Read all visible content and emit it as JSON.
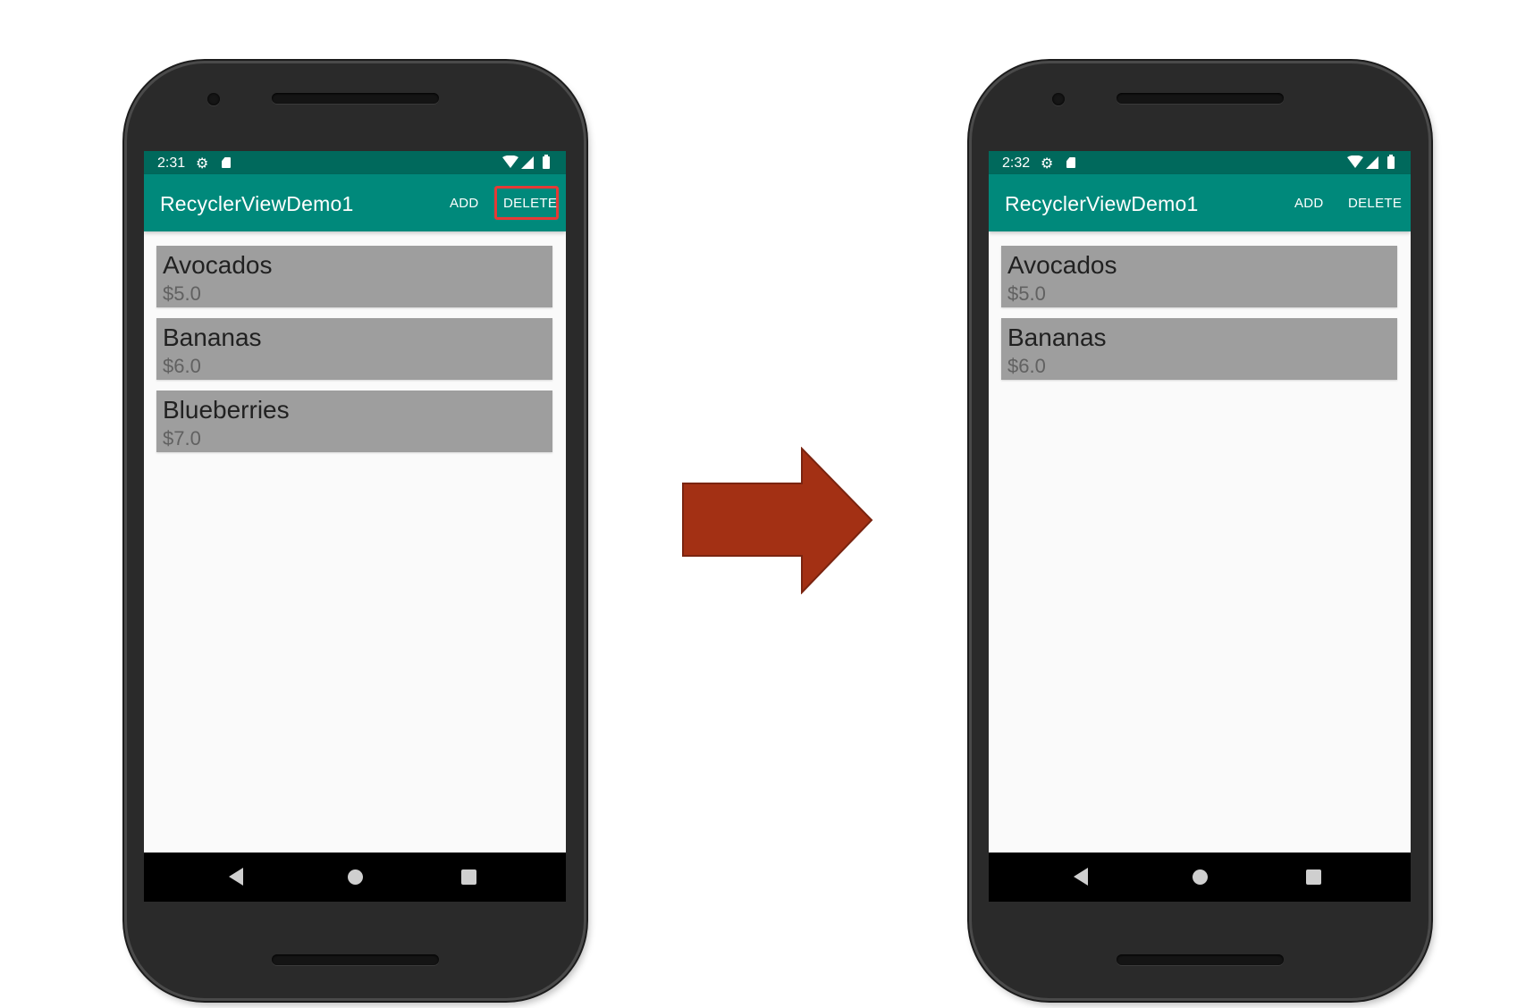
{
  "before": {
    "status": {
      "time": "2:31"
    },
    "app_title": "RecyclerViewDemo1",
    "actions": {
      "add": "ADD",
      "delete": "DELETE"
    },
    "highlighted_action": "delete",
    "items": [
      {
        "name": "Avocados",
        "price": "$5.0"
      },
      {
        "name": "Bananas",
        "price": "$6.0"
      },
      {
        "name": "Blueberries",
        "price": "$7.0"
      }
    ]
  },
  "after": {
    "status": {
      "time": "2:32"
    },
    "app_title": "RecyclerViewDemo1",
    "actions": {
      "add": "ADD",
      "delete": "DELETE"
    },
    "items": [
      {
        "name": "Avocados",
        "price": "$5.0"
      },
      {
        "name": "Bananas",
        "price": "$6.0"
      }
    ]
  },
  "colors": {
    "status_bar": "#00695c",
    "toolbar": "#00897b",
    "item_background": "#9e9e9e",
    "highlight_border": "#e53935",
    "arrow": "#a33014"
  },
  "icons": {
    "status": [
      "gear-icon",
      "sd-card-icon",
      "wifi-icon",
      "cell-signal-icon",
      "battery-icon"
    ],
    "navigation": [
      "back-icon",
      "home-icon",
      "recents-icon"
    ],
    "transition": "right-arrow-icon"
  }
}
